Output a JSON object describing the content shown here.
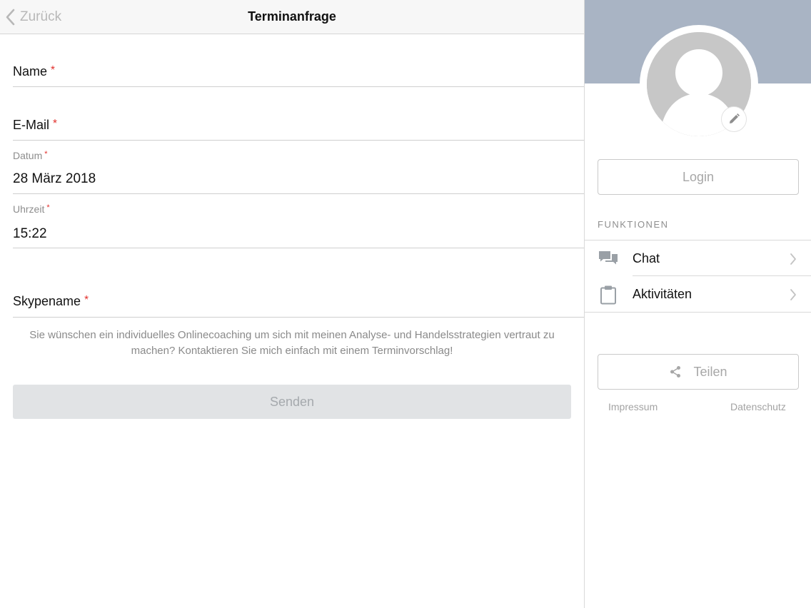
{
  "navbar": {
    "back_label": "Zurück",
    "title": "Terminanfrage"
  },
  "form": {
    "name_label": "Name",
    "email_label": "E-Mail",
    "datum_label": "Datum",
    "datum_value": "28 März 2018",
    "uhrzeit_label": "Uhrzeit",
    "uhrzeit_value": "15:22",
    "skype_label": "Skypename",
    "required_mark": "*",
    "info_text": "Sie wünschen ein individuelles Onlinecoaching um sich mit meinen Analyse- und Handelsstrategien vertraut zu machen? Kontaktieren Sie mich einfach mit einem Terminvorschlag!",
    "send_label": "Senden"
  },
  "sidebar": {
    "login_label": "Login",
    "section_title": "FUNKTIONEN",
    "items": [
      {
        "label": "Chat",
        "icon": "chat-icon"
      },
      {
        "label": "Aktivitäten",
        "icon": "clipboard-icon"
      }
    ],
    "share_label": "Teilen",
    "share_icon": "share-icon",
    "impressum_label": "Impressum",
    "datenschutz_label": "Datenschutz",
    "banner_color": "#a9b4c4"
  }
}
